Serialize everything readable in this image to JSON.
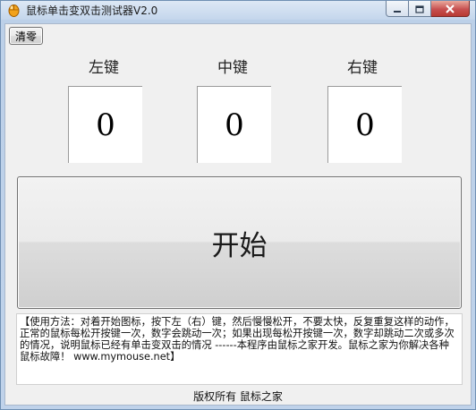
{
  "window": {
    "title": "鼠标单击变双击测试器V2.0"
  },
  "toolbar": {
    "reset_label": "清零"
  },
  "keys": [
    {
      "label": "左键",
      "count": "0"
    },
    {
      "label": "中键",
      "count": "0"
    },
    {
      "label": "右键",
      "count": "0"
    }
  ],
  "start_button": {
    "label": "开始"
  },
  "instructions": {
    "text": "【使用方法：对着开始图标，按下左（右）键，然后慢慢松开，不要太快，反复重复这样的动作，正常的鼠标每松开按键一次，数字会跳动一次；如果出现每松开按键一次，数字却跳动二次或多次的情况，说明鼠标已经有单击变双击的情况 ------本程序由鼠标之家开发。鼠标之家为你解决各种鼠标故障！ www.mymouse.net】"
  },
  "footer": {
    "text": "版权所有 鼠标之家"
  },
  "colors": {
    "titlebar": "#c4d6ec",
    "close_button": "#c75050",
    "client_bg": "#f0f0f0"
  },
  "icons": {
    "app": "mouse-icon",
    "minimize": "minimize-icon",
    "maximize": "maximize-icon",
    "close": "close-icon"
  }
}
